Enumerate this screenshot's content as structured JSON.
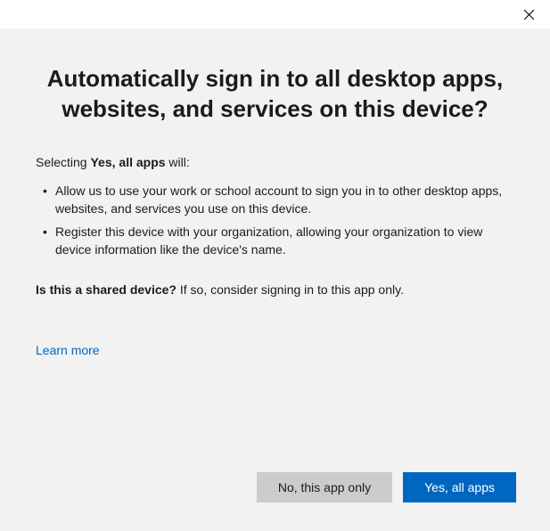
{
  "heading": "Automatically sign in to all desktop apps, websites, and services on this device?",
  "intro": {
    "prefix": "Selecting ",
    "bold": "Yes, all apps",
    "suffix": " will:"
  },
  "bullets": [
    "Allow us to use your work or school account to sign you in to other desktop apps, websites, and services you use on this device.",
    "Register this device with your organization, allowing your organization to view device information like the device's name."
  ],
  "question": {
    "bold": "Is this a shared device?",
    "suffix": " If so, consider signing in to this app only."
  },
  "learn_more": "Learn more",
  "buttons": {
    "secondary": "No, this app only",
    "primary": "Yes, all apps"
  }
}
